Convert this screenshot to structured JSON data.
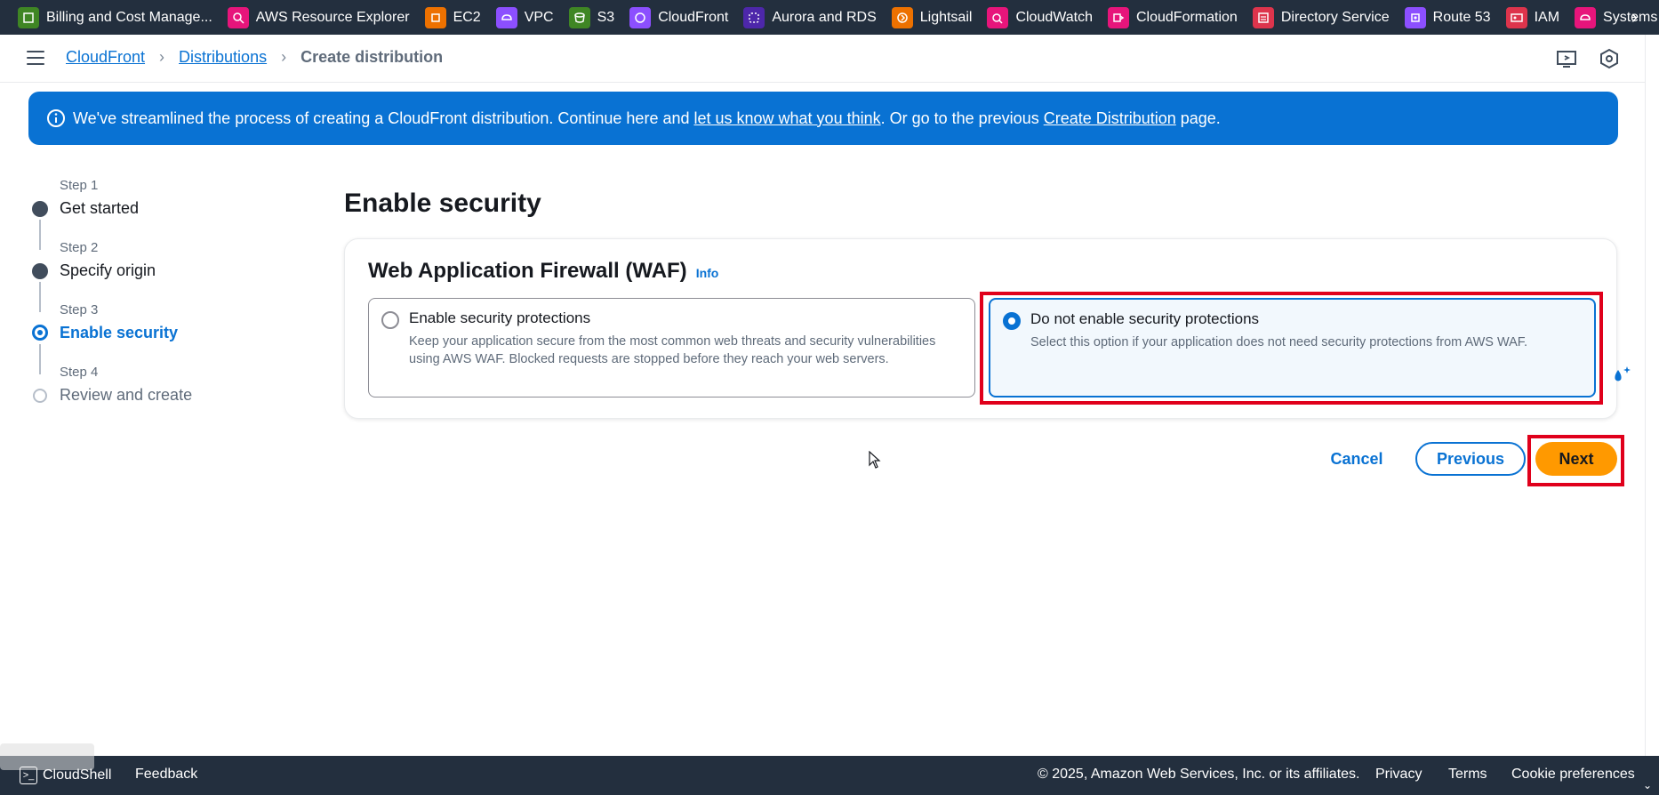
{
  "service_bar": {
    "items": [
      {
        "label": "Billing and Cost Manage...",
        "icon": "billing-icon",
        "color": "#3f8624"
      },
      {
        "label": "AWS Resource Explorer",
        "icon": "resource-explorer-icon",
        "color": "#e7157b"
      },
      {
        "label": "EC2",
        "icon": "ec2-icon",
        "color": "#ed7100"
      },
      {
        "label": "VPC",
        "icon": "vpc-icon",
        "color": "#8c4fff"
      },
      {
        "label": "S3",
        "icon": "s3-icon",
        "color": "#3f8624"
      },
      {
        "label": "CloudFront",
        "icon": "cloudfront-icon",
        "color": "#8c4fff"
      },
      {
        "label": "Aurora and RDS",
        "icon": "rds-icon",
        "color": "#4d27aa"
      },
      {
        "label": "Lightsail",
        "icon": "lightsail-icon",
        "color": "#ed7100"
      },
      {
        "label": "CloudWatch",
        "icon": "cloudwatch-icon",
        "color": "#e7157b"
      },
      {
        "label": "CloudFormation",
        "icon": "cloudformation-icon",
        "color": "#e7157b"
      },
      {
        "label": "Directory Service",
        "icon": "directory-service-icon",
        "color": "#dd344c"
      },
      {
        "label": "Route 53",
        "icon": "route53-icon",
        "color": "#8c4fff"
      },
      {
        "label": "IAM",
        "icon": "iam-icon",
        "color": "#dd344c"
      },
      {
        "label": "Systems",
        "icon": "systems-manager-icon",
        "color": "#e7157b"
      }
    ]
  },
  "breadcrumb": {
    "items": [
      "CloudFront",
      "Distributions"
    ],
    "current": "Create distribution"
  },
  "flash": {
    "text_1": "We've streamlined the process of creating a CloudFront distribution. Continue here and ",
    "link_1": "let us know what you think",
    "text_2": ". Or go to the previous ",
    "link_2": "Create Distribution",
    "text_3": " page."
  },
  "steps": [
    {
      "num": "Step 1",
      "title": "Get started",
      "state": "done"
    },
    {
      "num": "Step 2",
      "title": "Specify origin",
      "state": "done"
    },
    {
      "num": "Step 3",
      "title": "Enable security",
      "state": "current"
    },
    {
      "num": "Step 4",
      "title": "Review and create",
      "state": "todo"
    }
  ],
  "main": {
    "title": "Enable security",
    "container": {
      "title": "Web Application Firewall (WAF)",
      "info": "Info",
      "options": [
        {
          "label": "Enable security protections",
          "description": "Keep your application secure from the most common web threats and security vulnerabilities using AWS WAF. Blocked requests are stopped before they reach your web servers.",
          "selected": false
        },
        {
          "label": "Do not enable security protections",
          "description": "Select this option if your application does not need security protections from AWS WAF.",
          "selected": true
        }
      ]
    }
  },
  "actions": {
    "cancel": "Cancel",
    "previous": "Previous",
    "next": "Next"
  },
  "footer": {
    "cloudshell": "CloudShell",
    "feedback": "Feedback",
    "copyright": "© 2025, Amazon Web Services, Inc. or its affiliates.",
    "privacy": "Privacy",
    "terms": "Terms",
    "cookie": "Cookie preferences"
  },
  "colors": {
    "nav_bg": "#232f3e",
    "accent": "#0972d3",
    "primary_button": "#ff9900",
    "highlight": "#e0001b"
  }
}
